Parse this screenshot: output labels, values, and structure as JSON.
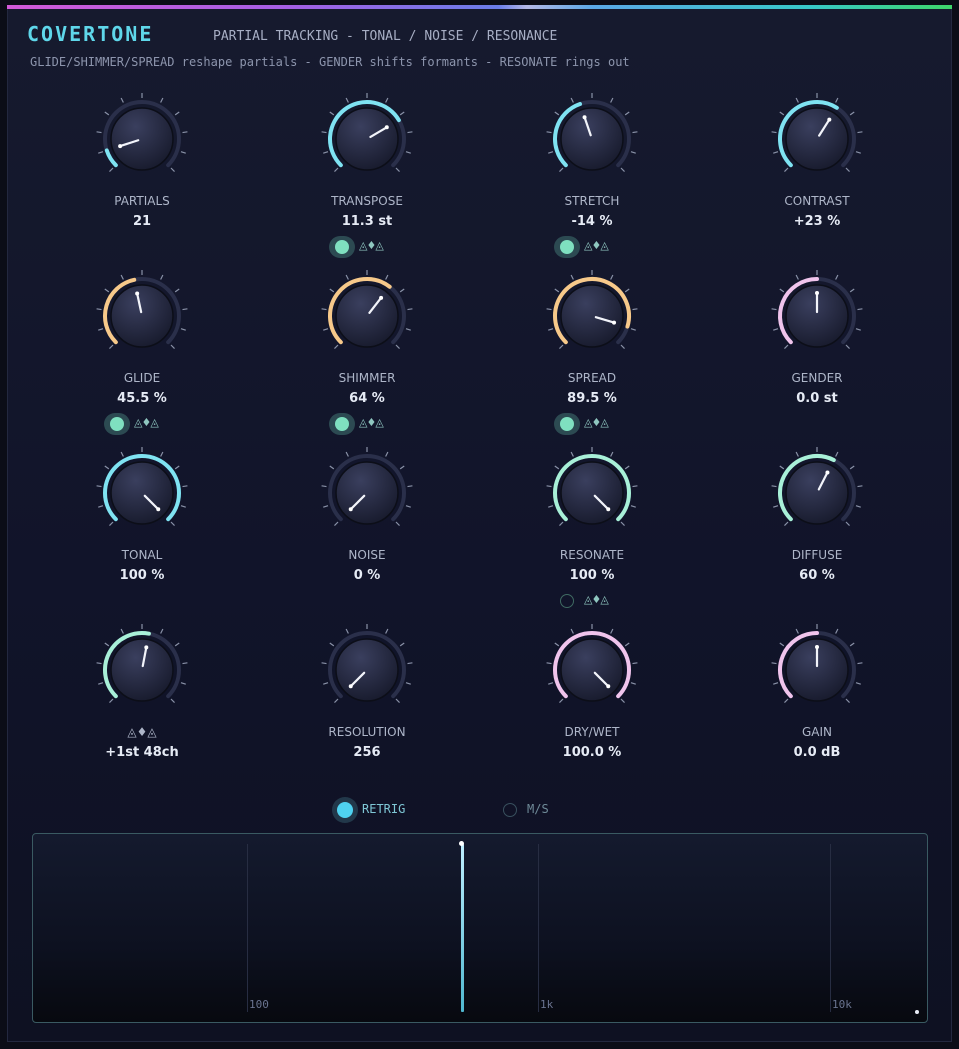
{
  "header": {
    "brand": "COVERTONE",
    "subtitle": "PARTIAL TRACKING - TONAL / NOISE / RESONANCE",
    "description": "GLIDE/SHIMMER/SPREAD reshape partials - GENDER shifts formants - RESONATE rings out"
  },
  "colors": {
    "accent": "#5fd7ea",
    "cyan_arc": "#7fe3f2",
    "orange_arc": "#f7c98a",
    "mint_arc": "#a8f0d8",
    "pink_arc": "#f0c4ec"
  },
  "knobs": [
    {
      "id": "partials",
      "label": "PARTIALS",
      "value": "21",
      "fraction": 0.1,
      "color": "#7fe3f2"
    },
    {
      "id": "transpose",
      "label": "TRANSPOSE",
      "value": "11.3 st",
      "fraction": 0.72,
      "color": "#7fe3f2"
    },
    {
      "id": "stretch",
      "label": "STRETCH",
      "value": "-14 %",
      "fraction": 0.43,
      "color": "#7fe3f2"
    },
    {
      "id": "contrast",
      "label": "CONTRAST",
      "value": "+23 %",
      "fraction": 0.62,
      "color": "#7fe3f2"
    },
    {
      "id": "glide",
      "label": "GLIDE",
      "value": "45.5 %",
      "fraction": 0.455,
      "color": "#f7c98a"
    },
    {
      "id": "shimmer",
      "label": "SHIMMER",
      "value": "64 %",
      "fraction": 0.64,
      "color": "#f7c98a"
    },
    {
      "id": "spread",
      "label": "SPREAD",
      "value": "89.5 %",
      "fraction": 0.895,
      "color": "#f7c98a"
    },
    {
      "id": "gender",
      "label": "GENDER",
      "value": "0.0 st",
      "fraction": 0.5,
      "color": "#f0c4ec"
    },
    {
      "id": "tonal",
      "label": "TONAL",
      "value": "100 %",
      "fraction": 1.0,
      "color": "#7fe3f2"
    },
    {
      "id": "noise",
      "label": "NOISE",
      "value": "0 %",
      "fraction": 0.0,
      "color": "#7fe3f2"
    },
    {
      "id": "resonate",
      "label": "RESONATE",
      "value": "100 %",
      "fraction": 1.0,
      "color": "#a8f0d8"
    },
    {
      "id": "diffuse",
      "label": "DIFFUSE",
      "value": "60 %",
      "fraction": 0.6,
      "color": "#a8f0d8"
    },
    {
      "id": "tracking",
      "label": "◬♦◬",
      "value": "+1st 48ch",
      "fraction": 0.54,
      "color": "#a8f0d8"
    },
    {
      "id": "resolution",
      "label": "RESOLUTION",
      "value": "256",
      "fraction": 0.0,
      "color": "#7fe3f2"
    },
    {
      "id": "drywet",
      "label": "DRY/WET",
      "value": "100.0 %",
      "fraction": 1.0,
      "color": "#f0c4ec"
    },
    {
      "id": "gain",
      "label": "GAIN",
      "value": "0.0 dB",
      "fraction": 0.5,
      "color": "#f0c4ec"
    }
  ],
  "mod_toggles": [
    {
      "id": "transpose-mod",
      "glyph": "◬♦◬",
      "on": true
    },
    {
      "id": "stretch-mod",
      "glyph": "◬♦◬",
      "on": true
    },
    {
      "id": "glide-mod",
      "glyph": "◬♦◬",
      "on": true
    },
    {
      "id": "shimmer-mod",
      "glyph": "◬♦◬",
      "on": true
    },
    {
      "id": "spread-mod",
      "glyph": "◬♦◬",
      "on": true
    },
    {
      "id": "resonate-mod",
      "glyph": "◬♦◬",
      "on": false
    }
  ],
  "toggles": [
    {
      "id": "retrig",
      "label": "RETRIG",
      "on": true
    },
    {
      "id": "ms",
      "label": "M/S",
      "on": false
    }
  ],
  "spectrum": {
    "grid_labels": [
      "100",
      "1k",
      "10k"
    ],
    "marker_freq_hz": 550
  }
}
